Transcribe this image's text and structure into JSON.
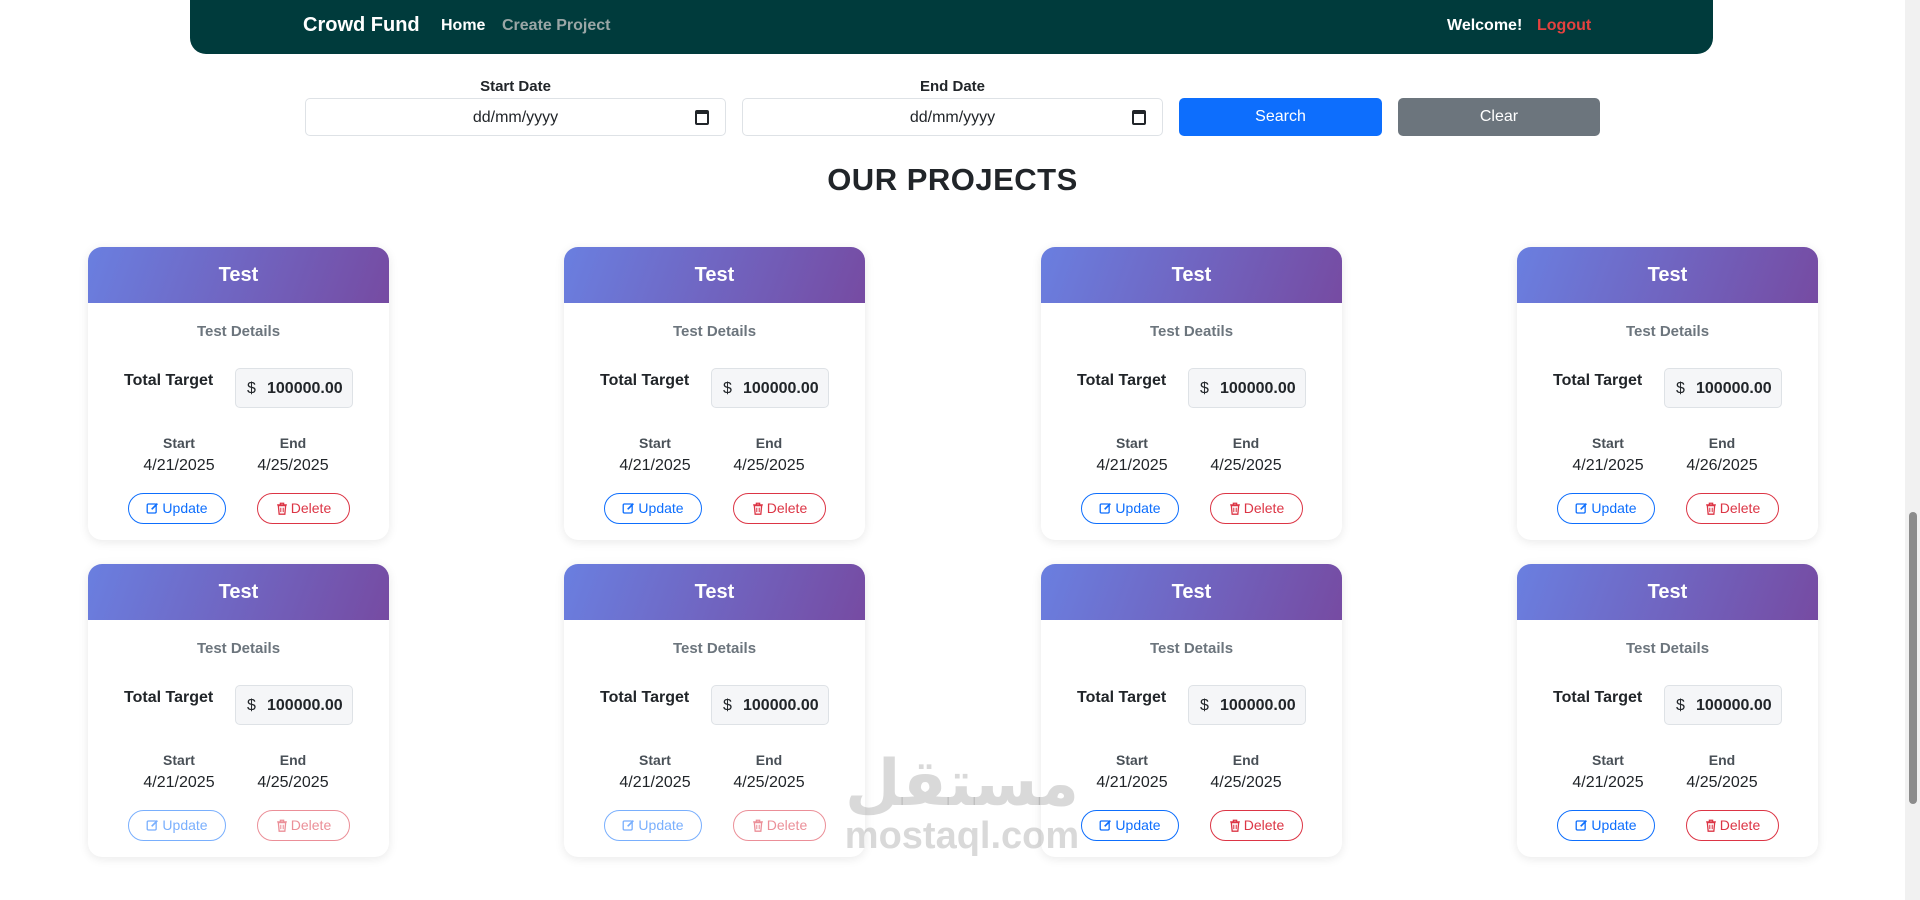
{
  "navbar": {
    "brand": "Crowd Fund",
    "home": "Home",
    "create_project": "Create Project",
    "welcome": "Welcome!",
    "logout": "Logout"
  },
  "filters": {
    "start_label": "Start Date",
    "end_label": "End Date",
    "start_placeholder": "dd/mm/yyyy",
    "end_placeholder": "dd/mm/yyyy",
    "search_label": "Search",
    "clear_label": "Clear"
  },
  "section_title": "OUR PROJECTS",
  "labels": {
    "total_target": "Total Target",
    "currency": "$",
    "start": "Start",
    "end": "End",
    "update": "Update",
    "delete": "Delete"
  },
  "projects": [
    {
      "title": "Test",
      "details": "Test Details",
      "target": "100000.00",
      "start": "4/21/2025",
      "end": "4/25/2025"
    },
    {
      "title": "Test",
      "details": "Test Details",
      "target": "100000.00",
      "start": "4/21/2025",
      "end": "4/25/2025"
    },
    {
      "title": "Test",
      "details": "Test Deatils",
      "target": "100000.00",
      "start": "4/21/2025",
      "end": "4/25/2025"
    },
    {
      "title": "Test",
      "details": "Test Details",
      "target": "100000.00",
      "start": "4/21/2025",
      "end": "4/26/2025"
    },
    {
      "title": "Test",
      "details": "Test Details",
      "target": "100000.00",
      "start": "4/21/2025",
      "end": "4/25/2025"
    },
    {
      "title": "Test",
      "details": "Test Details",
      "target": "100000.00",
      "start": "4/21/2025",
      "end": "4/25/2025"
    },
    {
      "title": "Test",
      "details": "Test Details",
      "target": "100000.00",
      "start": "4/21/2025",
      "end": "4/25/2025"
    },
    {
      "title": "Test",
      "details": "Test Details",
      "target": "100000.00",
      "start": "4/21/2025",
      "end": "4/25/2025"
    }
  ],
  "watermark": {
    "arabic": "مستقل",
    "latin": "mostaql.com"
  },
  "colors": {
    "navbar": "#003b3c",
    "logout": "#e4423f",
    "search_button": "#0d6efd",
    "clear_button": "#6c757d",
    "card_header_from": "#6a7fe0",
    "card_header_to": "#764ba2",
    "update": "#0d6efd",
    "delete": "#dc3545"
  }
}
